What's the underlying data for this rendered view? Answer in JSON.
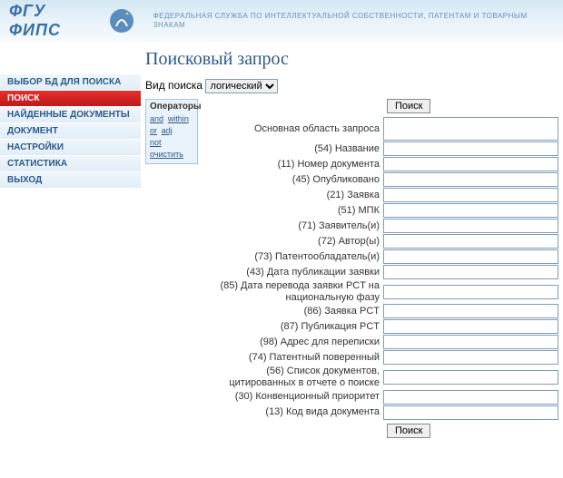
{
  "header": {
    "logo_text": "ФГУ ФИПС",
    "subtitle": "ФЕДЕРАЛЬНАЯ СЛУЖБА ПО ИНТЕЛЛЕКТУАЛЬНОЙ СОБСТВЕННОСТИ, ПАТЕНТАМ И ТОВАРНЫМ ЗНАКАМ"
  },
  "sidebar": {
    "items": [
      {
        "label": "ВЫБОР БД ДЛЯ ПОИСКА",
        "active": false
      },
      {
        "label": "ПОИСК",
        "active": true
      },
      {
        "label": "НАЙДЕННЫЕ ДОКУМЕНТЫ",
        "active": false
      },
      {
        "label": "ДОКУМЕНТ",
        "active": false
      },
      {
        "label": "НАСТРОЙКИ",
        "active": false
      },
      {
        "label": "СТАТИСТИКА",
        "active": false
      },
      {
        "label": "ВЫХОД",
        "active": false
      }
    ]
  },
  "main": {
    "title": "Поисковый запрос",
    "search_type_label": "Вид поиска",
    "search_type_value": "логический",
    "operators": {
      "title": "Операторы",
      "links": [
        "and",
        "within",
        "or",
        "adj",
        "not",
        "очистить"
      ]
    },
    "search_button": "Поиск",
    "fields": [
      {
        "label": "Основная область запроса",
        "value": ""
      },
      {
        "label": "(54) Название",
        "value": ""
      },
      {
        "label": "(11) Номер документа",
        "value": ""
      },
      {
        "label": "(45) Опубликовано",
        "value": ""
      },
      {
        "label": "(21) Заявка",
        "value": ""
      },
      {
        "label": "(51) МПК",
        "value": ""
      },
      {
        "label": "(71) Заявитель(и)",
        "value": ""
      },
      {
        "label": "(72) Автор(ы)",
        "value": ""
      },
      {
        "label": "(73) Патентообладатель(и)",
        "value": ""
      },
      {
        "label": "(43) Дата публикации заявки",
        "value": ""
      },
      {
        "label": "(85) Дата перевода заявки PCT на национальную фазу",
        "value": ""
      },
      {
        "label": "(86) Заявка PCT",
        "value": ""
      },
      {
        "label": "(87) Публикация PCT",
        "value": ""
      },
      {
        "label": "(98) Адрес для переписки",
        "value": ""
      },
      {
        "label": "(74) Патентный поверенный",
        "value": ""
      },
      {
        "label": "(56) Список документов, цитированных в отчете о поиске",
        "value": ""
      },
      {
        "label": "(30) Конвенционный приоритет",
        "value": ""
      },
      {
        "label": "(13) Код вида документа",
        "value": ""
      }
    ]
  }
}
